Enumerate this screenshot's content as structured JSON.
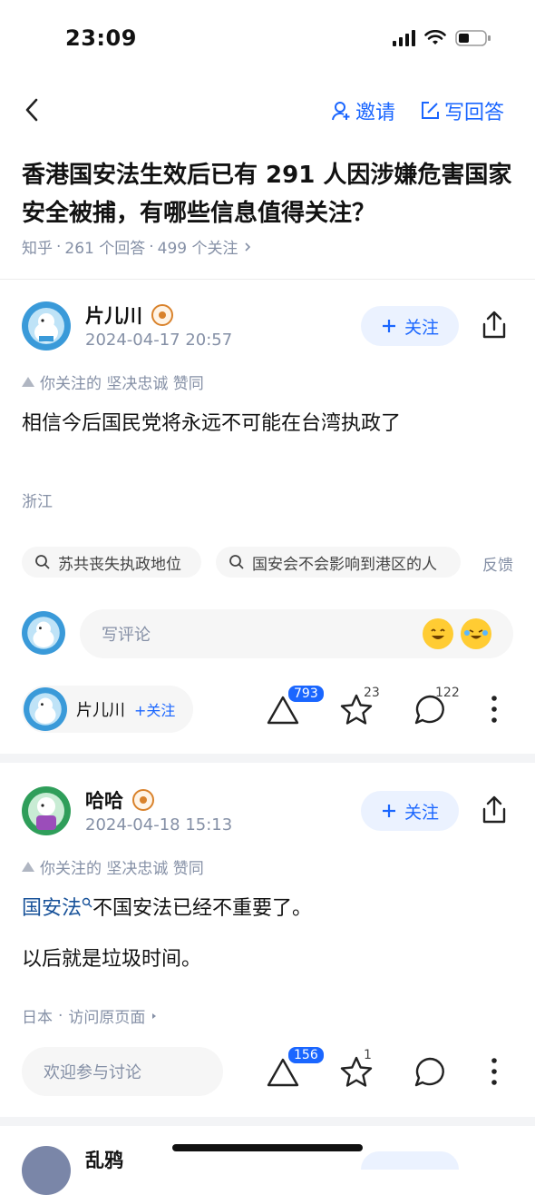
{
  "status_bar": {
    "time": "23:09"
  },
  "nav": {
    "invite_label": "邀请",
    "write_label": "写回答"
  },
  "question": {
    "title": "香港国安法生效后已有 291 人因涉嫌危害国家安全被捕，有哪些信息值得关注？",
    "source": "知乎",
    "answers_count": "261 个回答",
    "followers_count": "499 个关注",
    "sep": "·"
  },
  "answers": [
    {
      "author": "片儿川",
      "time": "2024-04-17 20:57",
      "follow_label": "关注",
      "approve_text": "你关注的 坚决忠诚 赞同",
      "content": "相信今后国民党将永远不可能在台湾执政了",
      "location": "浙江",
      "chips": [
        "苏共丧失执政地位",
        "国安会不会影响到港区的人"
      ],
      "feedback": "反馈",
      "comment_placeholder": "写评论",
      "author_pill_follow": "+关注",
      "upvotes": "793",
      "favorites": "23",
      "comments": "122"
    },
    {
      "author": "哈哈",
      "time": "2024-04-18 15:13",
      "follow_label": "关注",
      "approve_text": "你关注的 坚决忠诚 赞同",
      "keyword": "国安法",
      "content_rest": "不国安法已经不重要了。",
      "content_line2": "以后就是垃圾时间。",
      "location": "日本",
      "visit_original": "访问原页面",
      "sep": "·",
      "comment_placeholder": "欢迎参与讨论",
      "upvotes": "156",
      "favorites": "1"
    },
    {
      "author": "乱鸦"
    }
  ],
  "colors": {
    "accent": "#1a66ff",
    "muted": "#8590a6",
    "keyword": "#175199"
  }
}
